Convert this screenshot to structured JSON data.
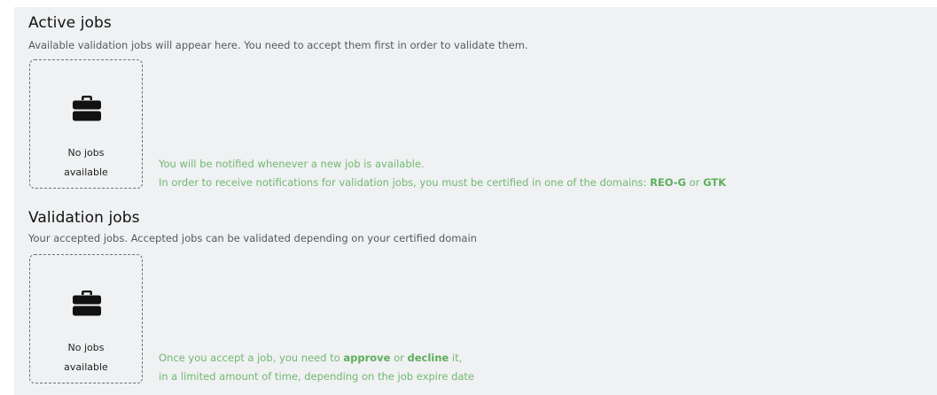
{
  "active_jobs": {
    "title": "Active jobs",
    "description": "Available validation jobs will appear here. You need to accept them first in order to validate them.",
    "empty_state": {
      "icon": "briefcase-icon",
      "line1": "No jobs",
      "line2": "available"
    },
    "hint": {
      "line1": "You will be notified whenever a new job is available.",
      "line2_prefix": "In order to receive notifications for validation jobs, you must be certified in one of the domains: ",
      "domain1": "REO-G",
      "connector": " or ",
      "domain2": "GTK"
    }
  },
  "validation_jobs": {
    "title": "Validation jobs",
    "description": "Your accepted jobs. Accepted jobs can be validated depending on your certified domain",
    "empty_state": {
      "icon": "briefcase-icon",
      "line1": "No jobs",
      "line2": "available"
    },
    "hint": {
      "line1_prefix": "Once you accept a job, you need to ",
      "approve": "approve",
      "connector": " or ",
      "decline": "decline",
      "line1_suffix": " it,",
      "line2": "in a limited amount of time, depending on the job expire date"
    }
  },
  "colors": {
    "panel_background": "#eff1f3",
    "hint_green": "#72b870",
    "title_text": "#111111",
    "description_text": "#555a5f"
  }
}
